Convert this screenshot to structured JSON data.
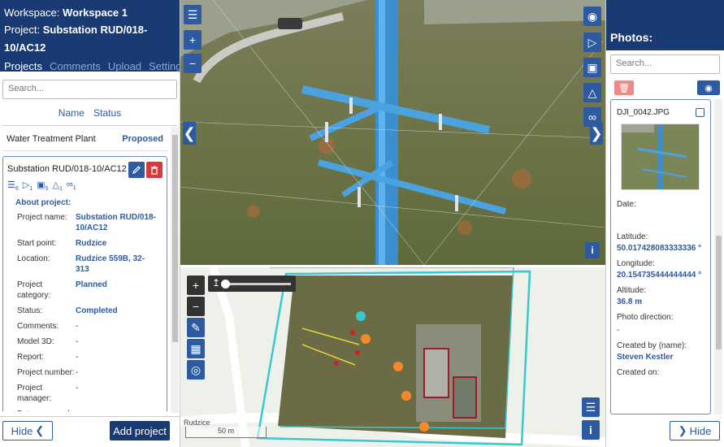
{
  "workspace": {
    "label": "Workspace:",
    "name": "Workspace 1"
  },
  "project": {
    "label": "Project:",
    "name": "Substation RUD/018-10/AC12"
  },
  "tabs": [
    "Projects",
    "Comments",
    "Upload",
    "Settings"
  ],
  "left_search": {
    "placeholder": "Search..."
  },
  "list_columns": {
    "name": "Name",
    "status": "Status"
  },
  "projects": [
    {
      "name": "Water Treatment Plant",
      "status": "Proposed"
    },
    {
      "name": "Substation RUD/018-10/AC12"
    }
  ],
  "project_counts": [
    {
      "icon": "layers-icon",
      "count": "6"
    },
    {
      "icon": "play-icon",
      "count": "1"
    },
    {
      "icon": "image-icon",
      "count": "5"
    },
    {
      "icon": "tower-icon",
      "count": "1"
    },
    {
      "icon": "paperclip-icon",
      "count": "1"
    }
  ],
  "about": {
    "title": "About project:",
    "fields": [
      {
        "k": "Project name:",
        "v": "Substation RUD/018-10/AC12"
      },
      {
        "k": "Start point:",
        "v": "Rudzice"
      },
      {
        "k": "Location:",
        "v": "Rudzice 559B, 32-313"
      },
      {
        "k": "Project category:",
        "v": "Planned"
      },
      {
        "k": "Status:",
        "v": "Completed"
      },
      {
        "k": "Comments:",
        "v": "-"
      },
      {
        "k": "Model 3D:",
        "v": "-"
      },
      {
        "k": "Report:",
        "v": "-"
      },
      {
        "k": "Project number:",
        "v": "-"
      },
      {
        "k": "Project manager:",
        "v": "-"
      },
      {
        "k": "Date surveyed:",
        "v": "-"
      }
    ]
  },
  "left_footer": {
    "hide": "Hide",
    "add": "Add project"
  },
  "map": {
    "place_label": "Rudzice",
    "scale": "50 m"
  },
  "photos": {
    "title": "Photos:",
    "search_placeholder": "Search...",
    "filename": "DJI_0042.JPG",
    "date_label": "Date:",
    "date_value": "",
    "latitude_label": "Latitude:",
    "latitude": "50.017428083333336 °",
    "longitude_label": "Longitude:",
    "longitude": "20.154735444444444 °",
    "altitude_label": "Altitude:",
    "altitude": "36.8 m",
    "direction_label": "Photo direction:",
    "direction": "-",
    "created_by_label": "Created by (name):",
    "created_by": "Steven Kestler",
    "created_on_label": "Created on:"
  },
  "right_footer": {
    "hide": "Hide"
  },
  "colors": {
    "header": "#1a3a73",
    "accent": "#2d5aa0",
    "delete": "#d83b3b"
  }
}
